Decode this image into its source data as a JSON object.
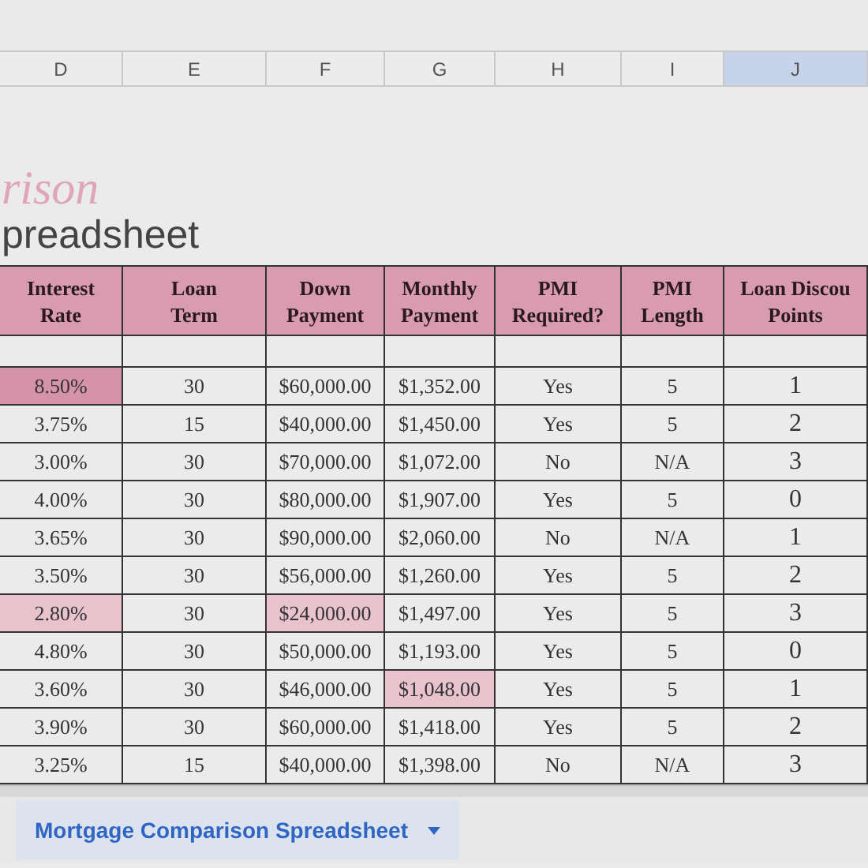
{
  "column_letters": [
    {
      "label": "D",
      "selected": false
    },
    {
      "label": "E",
      "selected": false
    },
    {
      "label": "F",
      "selected": false
    },
    {
      "label": "G",
      "selected": false
    },
    {
      "label": "H",
      "selected": false
    },
    {
      "label": "I",
      "selected": false
    },
    {
      "label": "J",
      "selected": true
    }
  ],
  "title": {
    "script_part": "rison",
    "plain_part": "preadsheet"
  },
  "table": {
    "columns": [
      "Interest Rate",
      "Loan Term",
      "Down Payment",
      "Monthly Payment",
      "PMI Required?",
      "PMI Length",
      "Loan Discou Points"
    ],
    "rows": [
      [
        {
          "text": "8.50%",
          "color": "#d493a8"
        },
        {
          "text": "30"
        },
        {
          "text": "$60,000.00"
        },
        {
          "text": "$1,352.00"
        },
        {
          "text": "Yes"
        },
        {
          "text": "5"
        },
        {
          "text": "1"
        }
      ],
      [
        {
          "text": "3.75%"
        },
        {
          "text": "15"
        },
        {
          "text": "$40,000.00"
        },
        {
          "text": "$1,450.00"
        },
        {
          "text": "Yes"
        },
        {
          "text": "5"
        },
        {
          "text": "2"
        }
      ],
      [
        {
          "text": "3.00%"
        },
        {
          "text": "30"
        },
        {
          "text": "$70,000.00"
        },
        {
          "text": "$1,072.00"
        },
        {
          "text": "No"
        },
        {
          "text": "N/A"
        },
        {
          "text": "3"
        }
      ],
      [
        {
          "text": "4.00%"
        },
        {
          "text": "30"
        },
        {
          "text": "$80,000.00"
        },
        {
          "text": "$1,907.00"
        },
        {
          "text": "Yes"
        },
        {
          "text": "5"
        },
        {
          "text": "0"
        }
      ],
      [
        {
          "text": "3.65%"
        },
        {
          "text": "30"
        },
        {
          "text": "$90,000.00"
        },
        {
          "text": "$2,060.00"
        },
        {
          "text": "No"
        },
        {
          "text": "N/A"
        },
        {
          "text": "1"
        }
      ],
      [
        {
          "text": "3.50%"
        },
        {
          "text": "30"
        },
        {
          "text": "$56,000.00"
        },
        {
          "text": "$1,260.00"
        },
        {
          "text": "Yes"
        },
        {
          "text": "5"
        },
        {
          "text": "2"
        }
      ],
      [
        {
          "text": "2.80%",
          "color": "#e8c3ce"
        },
        {
          "text": "30"
        },
        {
          "text": "$24,000.00",
          "color": "#e8c3ce"
        },
        {
          "text": "$1,497.00"
        },
        {
          "text": "Yes"
        },
        {
          "text": "5"
        },
        {
          "text": "3"
        }
      ],
      [
        {
          "text": "4.80%"
        },
        {
          "text": "30"
        },
        {
          "text": "$50,000.00"
        },
        {
          "text": "$1,193.00"
        },
        {
          "text": "Yes"
        },
        {
          "text": "5"
        },
        {
          "text": "0"
        }
      ],
      [
        {
          "text": "3.60%"
        },
        {
          "text": "30"
        },
        {
          "text": "$46,000.00"
        },
        {
          "text": "$1,048.00",
          "color": "#e8c3ce"
        },
        {
          "text": "Yes"
        },
        {
          "text": "5"
        },
        {
          "text": "1"
        }
      ],
      [
        {
          "text": "3.90%"
        },
        {
          "text": "30"
        },
        {
          "text": "$60,000.00"
        },
        {
          "text": "$1,418.00"
        },
        {
          "text": "Yes"
        },
        {
          "text": "5"
        },
        {
          "text": "2"
        }
      ],
      [
        {
          "text": "3.25%"
        },
        {
          "text": "15"
        },
        {
          "text": "$40,000.00"
        },
        {
          "text": "$1,398.00"
        },
        {
          "text": "No"
        },
        {
          "text": "N/A"
        },
        {
          "text": "3"
        }
      ]
    ]
  },
  "sheet_tabs": [
    {
      "label": "Mortgage Comparison Spreadsheet",
      "selected": true
    }
  ]
}
